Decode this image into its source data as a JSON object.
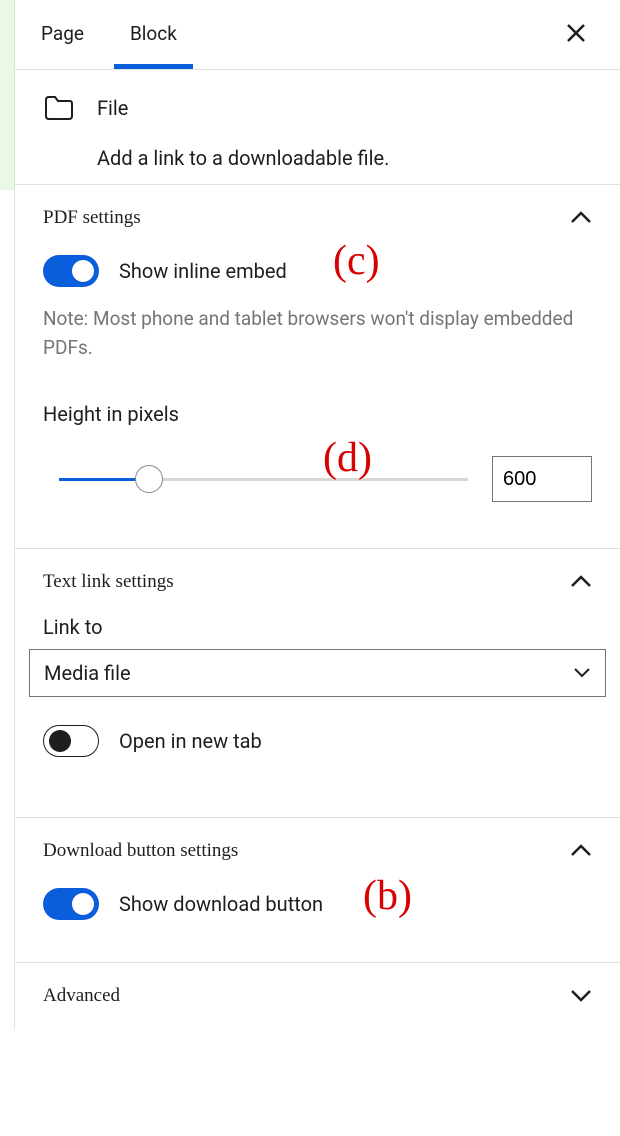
{
  "tabs": {
    "page": "Page",
    "block": "Block"
  },
  "block_header": {
    "title": "File",
    "description": "Add a link to a downloadable file."
  },
  "pdf_settings": {
    "title": "PDF settings",
    "show_inline_label": "Show inline embed",
    "note": "Note: Most phone and tablet browsers won't display embedded PDFs.",
    "height_label": "Height in pixels",
    "height_value": "600",
    "slider_percent": 22
  },
  "text_link_settings": {
    "title": "Text link settings",
    "link_to_label": "Link to",
    "link_to_value": "Media file",
    "open_new_tab_label": "Open in new tab"
  },
  "download_settings": {
    "title": "Download button settings",
    "show_download_label": "Show download button"
  },
  "advanced": {
    "title": "Advanced"
  },
  "annotations": {
    "c": "(c)",
    "d": "(d)",
    "b": "(b)"
  }
}
